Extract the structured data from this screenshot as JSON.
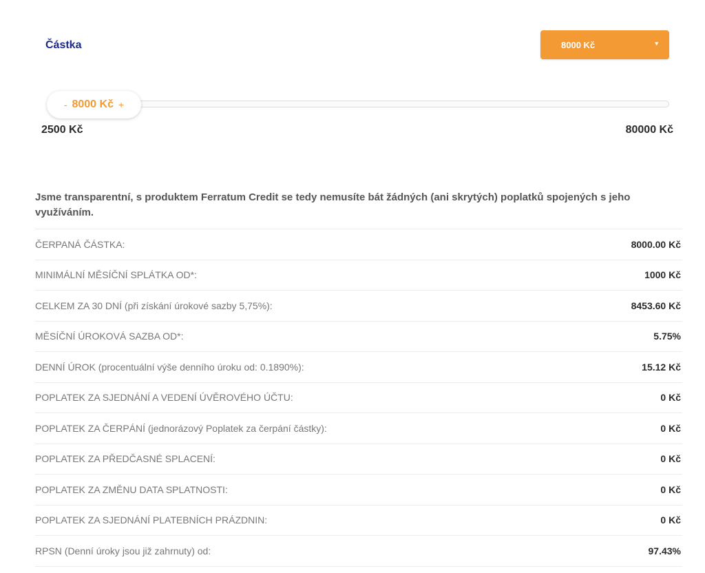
{
  "amount": {
    "label": "Částka",
    "select_value": "8000 Kč",
    "select_caret": "▾"
  },
  "slider": {
    "minus": "-",
    "plus": "+",
    "value_label": "8000 Kč",
    "value": 8000,
    "min_label": "2500 Kč",
    "max_label": "80000 Kč",
    "min": 2500,
    "max": 80000
  },
  "intro": "Jsme transparentní, s produktem Ferratum Credit se tedy nemusíte bát žádných (ani skrytých) poplatků spojených s jeho využíváním.",
  "fees": [
    {
      "label": "ČERPANÁ ČÁSTKA:",
      "value": "8000.00 Kč"
    },
    {
      "label": "MINIMÁLNÍ MĚSÍČNÍ SPLÁTKA OD*:",
      "value": "1000 Kč"
    },
    {
      "label": "CELKEM ZA 30 DNÍ (při získání úrokové sazby 5,75%):",
      "value": "8453.60 Kč"
    },
    {
      "label": "MĚSÍČNÍ ÚROKOVÁ SAZBA OD*:",
      "value": "5.75%"
    },
    {
      "label": "DENNÍ ÚROK (procentuální výše denního úroku od: 0.1890%):",
      "value": "15.12 Kč"
    },
    {
      "label": "POPLATEK ZA SJEDNÁNÍ A VEDENÍ ÚVĚROVÉHO ÚČTU:",
      "value": "0 Kč"
    },
    {
      "label": "POPLATEK ZA ČERPÁNÍ (jednorázový Poplatek za čerpání částky):",
      "value": "0 Kč"
    },
    {
      "label": "POPLATEK ZA PŘEDČASNÉ SPLACENÍ:",
      "value": "0 Kč"
    },
    {
      "label": "POPLATEK ZA ZMĚNU DATA SPLATNOSTI:",
      "value": "0 Kč"
    },
    {
      "label": "POPLATEK ZA SJEDNÁNÍ PLATEBNÍCH PRÁZDNIN:",
      "value": "0 Kč"
    },
    {
      "label": "RPSN (Denní úroky jsou již zahrnuty) od:",
      "value": "97.43%"
    }
  ],
  "colors": {
    "accent": "#f39a35",
    "heading": "#1a2b8f"
  }
}
